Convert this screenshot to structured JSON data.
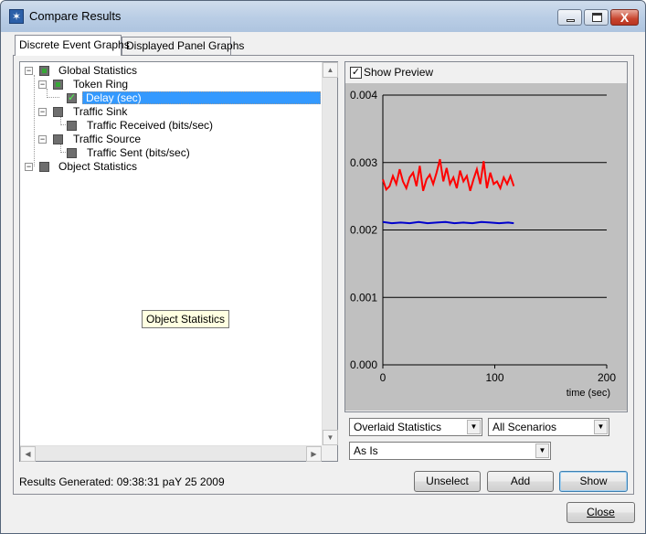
{
  "window": {
    "title": "Compare Results",
    "close_glyph": "X"
  },
  "tabs": [
    {
      "label": "Discrete Event Graphs",
      "active": true
    },
    {
      "label": "Displayed Panel Graphs",
      "active": false
    }
  ],
  "tree": {
    "items": [
      {
        "label": "Global Statistics"
      },
      {
        "label": "Token Ring"
      },
      {
        "label": "Delay (sec)"
      },
      {
        "label": "Traffic Sink"
      },
      {
        "label": "Traffic Received (bits/sec)"
      },
      {
        "label": "Traffic Source"
      },
      {
        "label": "Traffic Sent (bits/sec)"
      },
      {
        "label": "Object Statistics"
      }
    ]
  },
  "tooltip": {
    "text": "Object Statistics"
  },
  "preview": {
    "show_preview_label": "Show Preview",
    "checked": true
  },
  "chart_data": {
    "type": "line",
    "xlabel": "time (sec)",
    "ylabel": "",
    "xlim": [
      0,
      200
    ],
    "ylim": [
      0,
      0.004
    ],
    "xticks": [
      "0",
      "100",
      "200"
    ],
    "yticks": [
      "0.000",
      "0.001",
      "0.002",
      "0.003",
      "0.004"
    ],
    "grid": "horizontal",
    "background": "#c0c0c0",
    "series": [
      {
        "color": "#ff0000",
        "x": [
          0,
          3,
          6,
          9,
          12,
          15,
          18,
          21,
          24,
          27,
          30,
          33,
          36,
          39,
          42,
          45,
          48,
          51,
          54,
          57,
          60,
          63,
          66,
          69,
          72,
          75,
          78,
          81,
          84,
          87,
          90,
          93,
          96,
          99,
          102,
          105,
          108,
          111,
          114,
          117
        ],
        "y": [
          0.00275,
          0.0026,
          0.00265,
          0.0028,
          0.00268,
          0.0029,
          0.00272,
          0.00262,
          0.00278,
          0.00285,
          0.00265,
          0.00295,
          0.00258,
          0.00275,
          0.00282,
          0.00268,
          0.00285,
          0.00305,
          0.00272,
          0.00292,
          0.00268,
          0.00278,
          0.00262,
          0.00288,
          0.00272,
          0.0028,
          0.00258,
          0.00275,
          0.0029,
          0.00268,
          0.00302,
          0.00262,
          0.00285,
          0.00268,
          0.00272,
          0.00262,
          0.00278,
          0.00268,
          0.0028,
          0.00265
        ]
      },
      {
        "color": "#0000cc",
        "x": [
          0,
          8,
          16,
          24,
          32,
          40,
          48,
          56,
          64,
          72,
          80,
          88,
          96,
          104,
          112,
          117
        ],
        "y": [
          0.00212,
          0.0021,
          0.00211,
          0.0021,
          0.00212,
          0.0021,
          0.00211,
          0.00212,
          0.0021,
          0.00211,
          0.0021,
          0.00212,
          0.00211,
          0.0021,
          0.00211,
          0.0021
        ]
      }
    ]
  },
  "controls": {
    "overlay": {
      "value": "Overlaid Statistics"
    },
    "scenarios": {
      "value": "All Scenarios"
    },
    "filter": {
      "value": "As Is"
    }
  },
  "status": {
    "text": "Results Generated: 09:38:31 paY 25 2009"
  },
  "buttons": {
    "unselect": "Unselect",
    "add": "Add",
    "show": "Show",
    "close": "Close"
  }
}
